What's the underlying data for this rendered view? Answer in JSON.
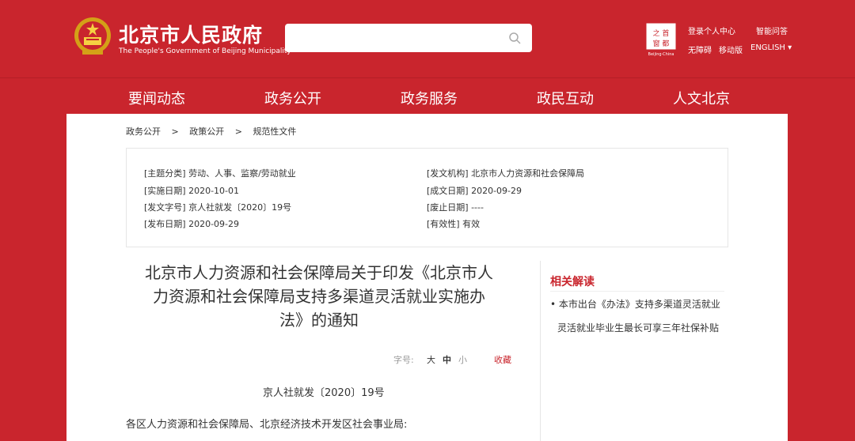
{
  "header": {
    "site_title": "北京市人民政府",
    "site_subtitle": "The People's Government of Beijing Municipality",
    "emblem_icon": "national-emblem-icon",
    "search_icon": "search-icon",
    "beijing_logo_text": "首都之窗",
    "beijing_logo_caption": "Beijing·China",
    "links": {
      "login": "登录个人中心",
      "smart_qa": "智能问答",
      "accessibility": "无障碍",
      "mobile": "移动版",
      "english": "ENGLISH ▾"
    }
  },
  "nav": {
    "items": [
      {
        "label": "要闻动态"
      },
      {
        "label": "政务公开"
      },
      {
        "label": "政务服务"
      },
      {
        "label": "政民互动"
      },
      {
        "label": "人文北京"
      }
    ]
  },
  "breadcrumb": [
    "政务公开",
    "政策公开",
    "规范性文件"
  ],
  "breadcrumb_sep": ">",
  "meta": {
    "topic": "[主题分类] 劳动、人事、监察/劳动就业",
    "issuer": "[发文机构] 北京市人力资源和社会保障局",
    "effective_date": "[实施日期] 2020-10-01",
    "written_date": "[成文日期] 2020-09-29",
    "doc_no": "[发文字号] 京人社就发〔2020〕19号",
    "abolish_date": "[废止日期] ----",
    "publish_date": "[发布日期] 2020-09-29",
    "validity": "[有效性] 有效"
  },
  "article": {
    "title_line1": "北京市人力资源和社会保障局关于印发《北京市人",
    "title_line2": "力资源和社会保障局支持多渠道灵活就业实施办",
    "title_line3": "法》的通知",
    "font_label": "字号:",
    "font_large": "大",
    "font_medium": "中",
    "font_small": "小",
    "favorite": "收藏",
    "doc_number": "京人社就发〔2020〕19号",
    "salutation": "各区人力资源和社会保障局、北京经济技术开发区社会事业局:"
  },
  "related": {
    "title": "相关解读",
    "items": [
      "• 本市出台《办法》支持多渠道灵活就业",
      "灵活就业毕业生最长可享三年社保补贴"
    ]
  },
  "colors": {
    "brand_red": "#c9252d",
    "white": "#ffffff",
    "text": "#333333",
    "muted": "#999999"
  }
}
